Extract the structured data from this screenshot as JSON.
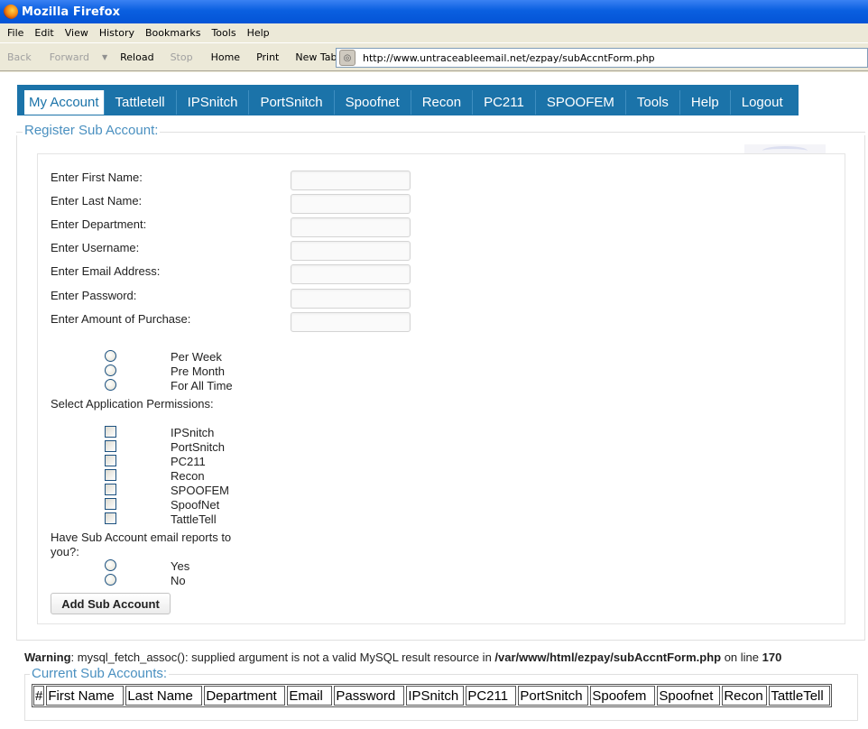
{
  "window": {
    "title": "Mozilla Firefox"
  },
  "menubar": {
    "items": [
      "File",
      "Edit",
      "View",
      "History",
      "Bookmarks",
      "Tools",
      "Help"
    ]
  },
  "toolbar": {
    "back": "Back",
    "forward": "Forward",
    "reload": "Reload",
    "stop": "Stop",
    "home": "Home",
    "print": "Print",
    "new_tab": "New Tab",
    "url": "http://www.untraceableemail.net/ezpay/subAccntForm.php"
  },
  "nav": {
    "items": [
      "My Account",
      "Tattletell",
      "IPSnitch",
      "PortSnitch",
      "Spoofnet",
      "Recon",
      "PC211",
      "SPOOFEM",
      "Tools",
      "Help",
      "Logout"
    ],
    "active": "My Account"
  },
  "form": {
    "legend": "Register Sub Account:",
    "fields": [
      {
        "label": "Enter First Name:",
        "value": ""
      },
      {
        "label": "Enter Last Name:",
        "value": ""
      },
      {
        "label": "Enter Department:",
        "value": ""
      },
      {
        "label": "Enter Username:",
        "value": ""
      },
      {
        "label": "Enter Email Address:",
        "value": ""
      },
      {
        "label": "Enter Password:",
        "value": ""
      },
      {
        "label": "Enter Amount of Purchase:",
        "value": ""
      }
    ],
    "period_options": [
      "Per Week",
      "Pre Month",
      "For All Time"
    ],
    "permissions_label": "Select Application Permissions:",
    "permissions": [
      "IPSnitch",
      "PortSnitch",
      "PC211",
      "Recon",
      "SPOOFEM",
      "SpoofNet",
      "TattleTell"
    ],
    "email_reports_label_line1": "Have Sub Account email reports to",
    "email_reports_label_line2": "you?:",
    "email_reports_options": [
      "Yes",
      "No"
    ],
    "submit_label": "Add Sub Account"
  },
  "warning": {
    "prefix": "Warning",
    "message": ": mysql_fetch_assoc(): supplied argument is not a valid MySQL result resource in ",
    "path": "/var/www/html/ezpay/subAccntForm.php",
    "on_line": " on line ",
    "line": "170"
  },
  "accounts": {
    "legend": "Current Sub Accounts:",
    "columns": [
      "#",
      "First Name",
      "Last Name",
      "Department",
      "Email",
      "Password",
      "IPSnitch",
      "PC211",
      "PortSnitch",
      "Spoofem",
      "Spoofnet",
      "Recon",
      "TattleTell"
    ]
  }
}
